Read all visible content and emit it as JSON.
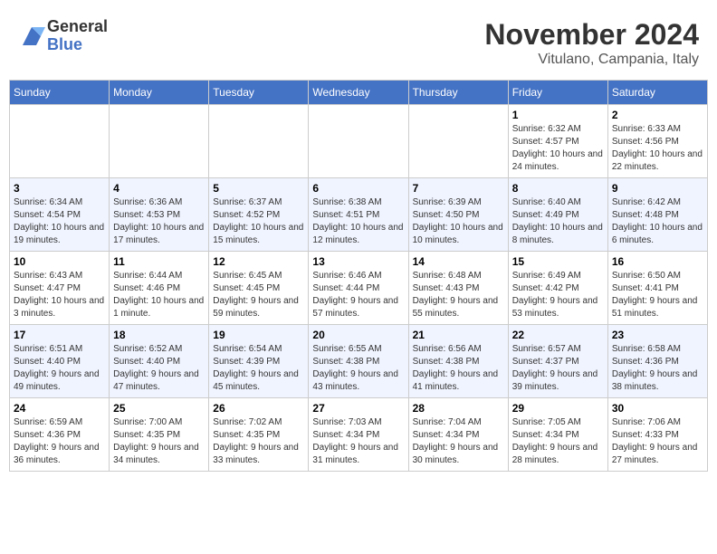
{
  "logo": {
    "general": "General",
    "blue": "Blue"
  },
  "title": "November 2024",
  "location": "Vitulano, Campania, Italy",
  "days_of_week": [
    "Sunday",
    "Monday",
    "Tuesday",
    "Wednesday",
    "Thursday",
    "Friday",
    "Saturday"
  ],
  "weeks": [
    [
      {
        "day": "",
        "info": ""
      },
      {
        "day": "",
        "info": ""
      },
      {
        "day": "",
        "info": ""
      },
      {
        "day": "",
        "info": ""
      },
      {
        "day": "",
        "info": ""
      },
      {
        "day": "1",
        "info": "Sunrise: 6:32 AM\nSunset: 4:57 PM\nDaylight: 10 hours and 24 minutes."
      },
      {
        "day": "2",
        "info": "Sunrise: 6:33 AM\nSunset: 4:56 PM\nDaylight: 10 hours and 22 minutes."
      }
    ],
    [
      {
        "day": "3",
        "info": "Sunrise: 6:34 AM\nSunset: 4:54 PM\nDaylight: 10 hours and 19 minutes."
      },
      {
        "day": "4",
        "info": "Sunrise: 6:36 AM\nSunset: 4:53 PM\nDaylight: 10 hours and 17 minutes."
      },
      {
        "day": "5",
        "info": "Sunrise: 6:37 AM\nSunset: 4:52 PM\nDaylight: 10 hours and 15 minutes."
      },
      {
        "day": "6",
        "info": "Sunrise: 6:38 AM\nSunset: 4:51 PM\nDaylight: 10 hours and 12 minutes."
      },
      {
        "day": "7",
        "info": "Sunrise: 6:39 AM\nSunset: 4:50 PM\nDaylight: 10 hours and 10 minutes."
      },
      {
        "day": "8",
        "info": "Sunrise: 6:40 AM\nSunset: 4:49 PM\nDaylight: 10 hours and 8 minutes."
      },
      {
        "day": "9",
        "info": "Sunrise: 6:42 AM\nSunset: 4:48 PM\nDaylight: 10 hours and 6 minutes."
      }
    ],
    [
      {
        "day": "10",
        "info": "Sunrise: 6:43 AM\nSunset: 4:47 PM\nDaylight: 10 hours and 3 minutes."
      },
      {
        "day": "11",
        "info": "Sunrise: 6:44 AM\nSunset: 4:46 PM\nDaylight: 10 hours and 1 minute."
      },
      {
        "day": "12",
        "info": "Sunrise: 6:45 AM\nSunset: 4:45 PM\nDaylight: 9 hours and 59 minutes."
      },
      {
        "day": "13",
        "info": "Sunrise: 6:46 AM\nSunset: 4:44 PM\nDaylight: 9 hours and 57 minutes."
      },
      {
        "day": "14",
        "info": "Sunrise: 6:48 AM\nSunset: 4:43 PM\nDaylight: 9 hours and 55 minutes."
      },
      {
        "day": "15",
        "info": "Sunrise: 6:49 AM\nSunset: 4:42 PM\nDaylight: 9 hours and 53 minutes."
      },
      {
        "day": "16",
        "info": "Sunrise: 6:50 AM\nSunset: 4:41 PM\nDaylight: 9 hours and 51 minutes."
      }
    ],
    [
      {
        "day": "17",
        "info": "Sunrise: 6:51 AM\nSunset: 4:40 PM\nDaylight: 9 hours and 49 minutes."
      },
      {
        "day": "18",
        "info": "Sunrise: 6:52 AM\nSunset: 4:40 PM\nDaylight: 9 hours and 47 minutes."
      },
      {
        "day": "19",
        "info": "Sunrise: 6:54 AM\nSunset: 4:39 PM\nDaylight: 9 hours and 45 minutes."
      },
      {
        "day": "20",
        "info": "Sunrise: 6:55 AM\nSunset: 4:38 PM\nDaylight: 9 hours and 43 minutes."
      },
      {
        "day": "21",
        "info": "Sunrise: 6:56 AM\nSunset: 4:38 PM\nDaylight: 9 hours and 41 minutes."
      },
      {
        "day": "22",
        "info": "Sunrise: 6:57 AM\nSunset: 4:37 PM\nDaylight: 9 hours and 39 minutes."
      },
      {
        "day": "23",
        "info": "Sunrise: 6:58 AM\nSunset: 4:36 PM\nDaylight: 9 hours and 38 minutes."
      }
    ],
    [
      {
        "day": "24",
        "info": "Sunrise: 6:59 AM\nSunset: 4:36 PM\nDaylight: 9 hours and 36 minutes."
      },
      {
        "day": "25",
        "info": "Sunrise: 7:00 AM\nSunset: 4:35 PM\nDaylight: 9 hours and 34 minutes."
      },
      {
        "day": "26",
        "info": "Sunrise: 7:02 AM\nSunset: 4:35 PM\nDaylight: 9 hours and 33 minutes."
      },
      {
        "day": "27",
        "info": "Sunrise: 7:03 AM\nSunset: 4:34 PM\nDaylight: 9 hours and 31 minutes."
      },
      {
        "day": "28",
        "info": "Sunrise: 7:04 AM\nSunset: 4:34 PM\nDaylight: 9 hours and 30 minutes."
      },
      {
        "day": "29",
        "info": "Sunrise: 7:05 AM\nSunset: 4:34 PM\nDaylight: 9 hours and 28 minutes."
      },
      {
        "day": "30",
        "info": "Sunrise: 7:06 AM\nSunset: 4:33 PM\nDaylight: 9 hours and 27 minutes."
      }
    ]
  ]
}
